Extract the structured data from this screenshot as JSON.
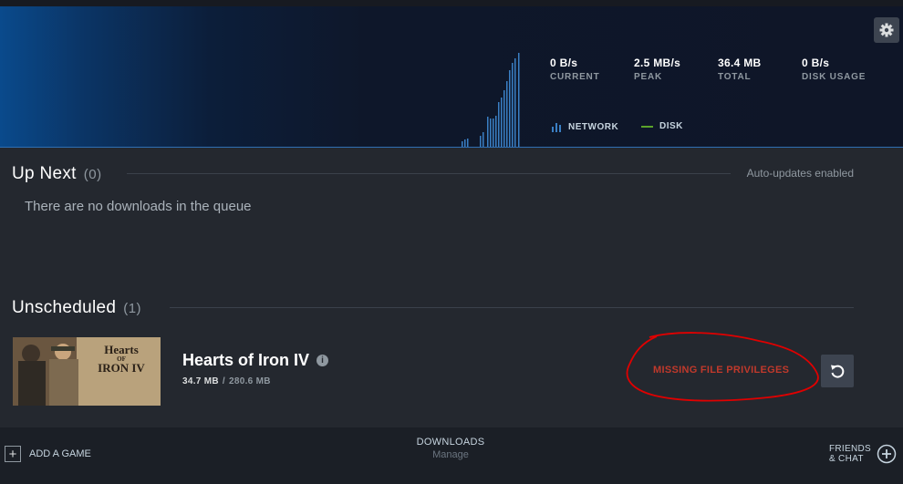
{
  "stats": [
    {
      "value": "0 B/s",
      "label": "CURRENT"
    },
    {
      "value": "2.5 MB/s",
      "label": "PEAK"
    },
    {
      "value": "36.4 MB",
      "label": "TOTAL"
    },
    {
      "value": "0 B/s",
      "label": "DISK USAGE"
    }
  ],
  "legend": {
    "network": "NETWORK",
    "disk": "DISK"
  },
  "colors": {
    "accent": "#2f6fb3",
    "network_bar": "#3a7fc4",
    "disk_line": "#5ba32b",
    "error": "#c0392b"
  },
  "icons": {
    "settings": "gear-icon",
    "retry": "retry-icon",
    "add": "plus-icon",
    "friends": "chat-plus-icon",
    "info": "info-icon"
  },
  "up_next": {
    "title": "Up Next",
    "count": "(0)",
    "auto_updates": "Auto-updates enabled",
    "empty_message": "There are no downloads in the queue"
  },
  "unscheduled": {
    "title": "Unscheduled",
    "count": "(1)",
    "game": {
      "title": "Hearts of Iron IV",
      "thumb_logo_top": "Hearts",
      "thumb_logo_mid": "OF",
      "thumb_logo_bottom": "IRON IV",
      "downloaded": "34.7 MB",
      "separator": "/",
      "total": "280.6 MB",
      "status": "MISSING FILE PRIVILEGES"
    }
  },
  "footer": {
    "add_game": "ADD A GAME",
    "downloads": "DOWNLOADS",
    "manage": "Manage",
    "friends_line1": "FRIENDS",
    "friends_line2": "& CHAT"
  }
}
